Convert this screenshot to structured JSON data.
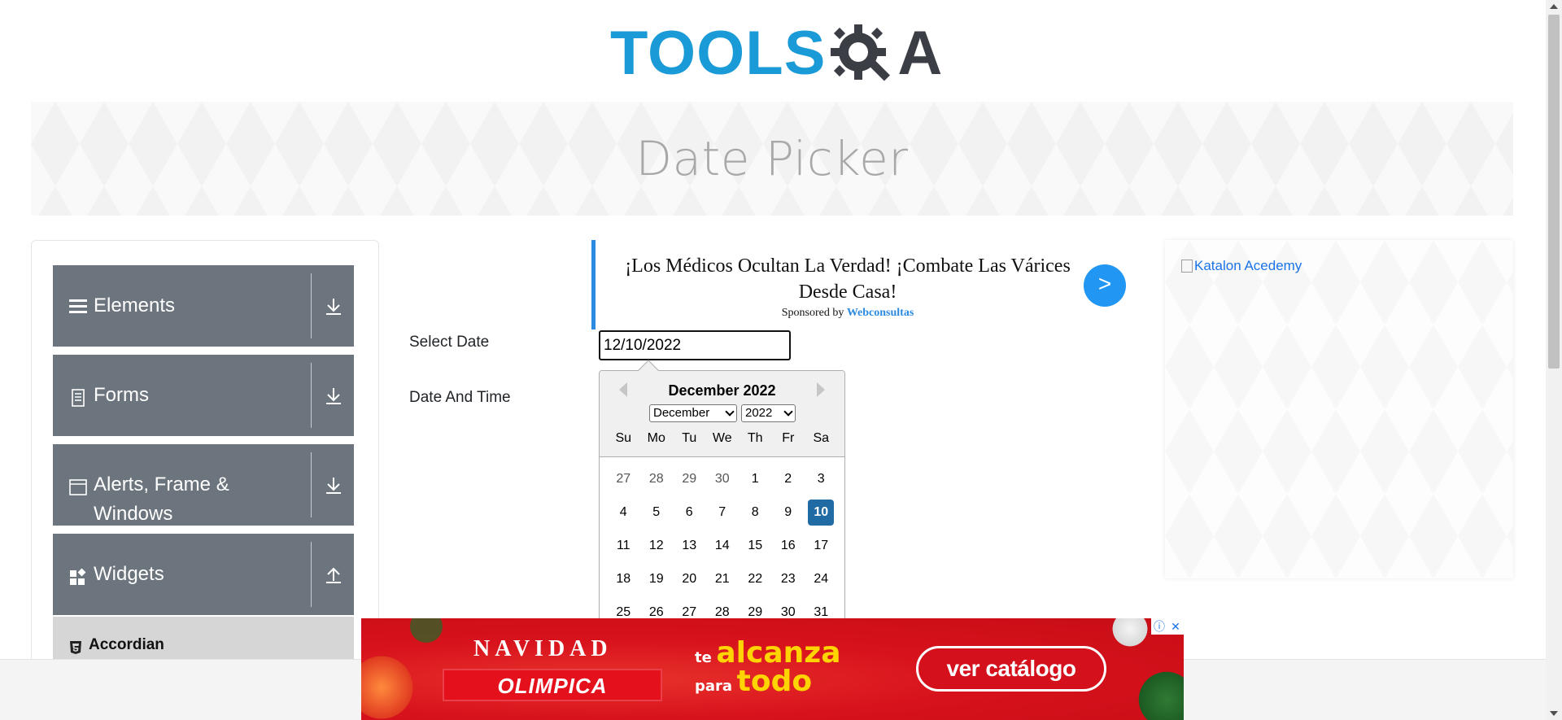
{
  "header": {
    "logo_tools": "TOOLS",
    "logo_qa": "A",
    "logo_color_tools": "#1a9ad6",
    "logo_color_qa": "#3b3f45"
  },
  "banner": {
    "title": "Date Picker"
  },
  "sidebar": {
    "groups": [
      {
        "label": "Elements",
        "icon": "hamburger-icon",
        "arrow": "download-icon"
      },
      {
        "label": "Forms",
        "icon": "document-icon",
        "arrow": "download-icon"
      },
      {
        "label": "Alerts, Frame &",
        "label2": "Windows",
        "icon": "window-icon",
        "arrow": "download-icon"
      },
      {
        "label": "Widgets",
        "icon": "widgets-icon",
        "arrow": "upload-icon"
      }
    ],
    "subitems": [
      {
        "label": "Accordian",
        "icon": "html5-icon"
      }
    ]
  },
  "ad_top": {
    "headline": "¡Los Médicos Ocultan La Verdad! ¡Combate Las Várices Desde Casa!",
    "sponsored_prefix": "Sponsored by",
    "sponsor": "Webconsultas",
    "go_label": ">"
  },
  "form": {
    "select_date_label": "Select Date",
    "select_date_value": "12/10/2022",
    "date_time_label": "Date And Time"
  },
  "datepicker": {
    "title": "December 2022",
    "month_select": "December",
    "year_select": "2022",
    "weekdays": [
      "Su",
      "Mo",
      "Tu",
      "We",
      "Th",
      "Fr",
      "Sa"
    ],
    "weeks": [
      [
        "27",
        "28",
        "29",
        "30",
        "1",
        "2",
        "3"
      ],
      [
        "4",
        "5",
        "6",
        "7",
        "8",
        "9",
        "10"
      ],
      [
        "11",
        "12",
        "13",
        "14",
        "15",
        "16",
        "17"
      ],
      [
        "18",
        "19",
        "20",
        "21",
        "22",
        "23",
        "24"
      ],
      [
        "25",
        "26",
        "27",
        "28",
        "29",
        "30",
        "31"
      ]
    ],
    "selected_day": "10",
    "selected_color": "#216ba5"
  },
  "side_ad": {
    "alt_text": "Katalon Acedemy"
  },
  "bottom_ad": {
    "navidad": "NAVIDAD",
    "brand": "OLIMPICA",
    "slogan_1": "te",
    "slogan_2": "alcanza",
    "slogan_3": "para",
    "slogan_4": "todo",
    "cta": "ver catálogo",
    "info_icon": "ⓘ",
    "close_icon": "✕"
  }
}
